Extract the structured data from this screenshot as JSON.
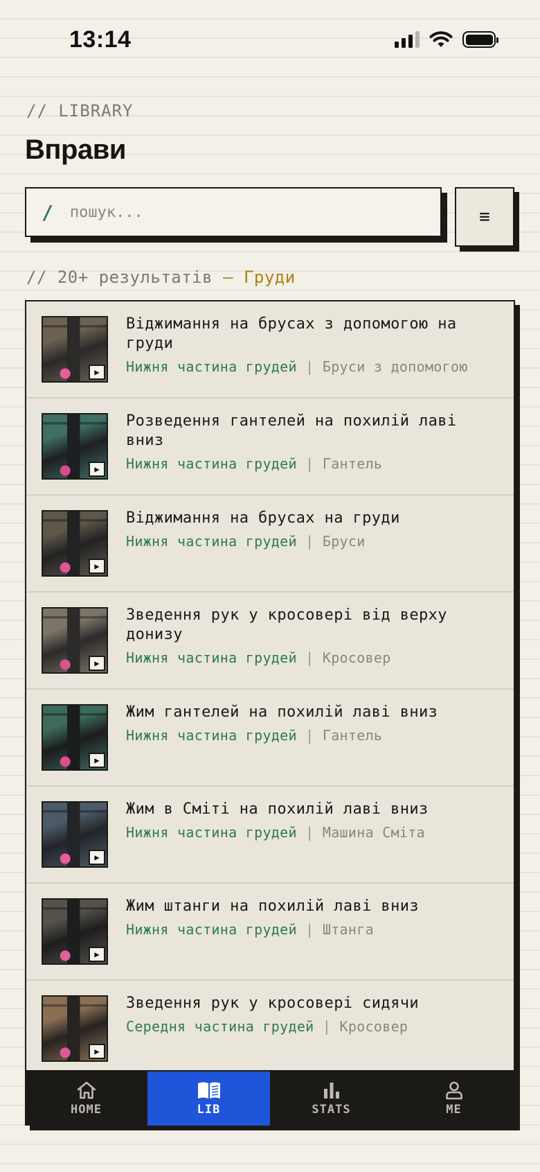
{
  "status_bar": {
    "time": "13:14"
  },
  "header": {
    "eyebrow": "// LIBRARY",
    "title": "Вправи"
  },
  "search": {
    "prefix": "/",
    "placeholder": "пошук...",
    "value": ""
  },
  "filter_button": {
    "icon": "filter-lines-icon",
    "glyph": "≡"
  },
  "results": {
    "prefix": "// 20+ результатів",
    "dash": " — ",
    "filter": "Груди"
  },
  "exercises": [
    {
      "title": "Віджимання на брусах з допомогою на груди",
      "muscle": "Нижня частина грудей",
      "separator": " | ",
      "equipment": "Бруси з допомогою",
      "thumb_colors": [
        "#6b6253",
        "#2b2a28",
        "#e85d9b"
      ]
    },
    {
      "title": "Розведення гантелей на похилій лаві вниз",
      "muscle": "Нижня частина грудей",
      "separator": " | ",
      "equipment": "Гантель",
      "thumb_colors": [
        "#3f6f63",
        "#1d1f22",
        "#d94d8f"
      ]
    },
    {
      "title": "Віджимання на брусах на груди",
      "muscle": "Нижня частина грудей",
      "separator": " | ",
      "equipment": "Бруси",
      "thumb_colors": [
        "#5e574c",
        "#222222",
        "#e05594"
      ]
    },
    {
      "title": "Зведення рук у кросовері від верху донизу",
      "muscle": "Нижня частина грудей",
      "separator": " | ",
      "equipment": "Кросовер",
      "thumb_colors": [
        "#7b7468",
        "#2c2b2a",
        "#d6558e"
      ]
    },
    {
      "title": "Жим гантелей на похилій лаві вниз",
      "muscle": "Нижня частина грудей",
      "separator": " | ",
      "equipment": "Гантель",
      "thumb_colors": [
        "#3d6a5c",
        "#1b1c1e",
        "#d9508c"
      ]
    },
    {
      "title": "Жим в Сміті на похилій лаві вниз",
      "muscle": "Нижня частина грудей",
      "separator": " | ",
      "equipment": "Машина Сміта",
      "thumb_colors": [
        "#4b5a66",
        "#222428",
        "#e85d9b"
      ]
    },
    {
      "title": "Жим штанги на похилій лаві вниз",
      "muscle": "Нижня частина грудей",
      "separator": " | ",
      "equipment": "Штанга",
      "thumb_colors": [
        "#55524c",
        "#1d1d1d",
        "#e0609a"
      ]
    },
    {
      "title": "Зведення рук у кросовері сидячи",
      "muscle": "Середня частина грудей",
      "separator": " | ",
      "equipment": "Кросовер",
      "thumb_colors": [
        "#8a6f55",
        "#262321",
        "#de5a95"
      ]
    }
  ],
  "tabs": [
    {
      "label": "HOME",
      "icon": "home-icon",
      "active": false
    },
    {
      "label": "LIB",
      "icon": "book-icon",
      "active": true
    },
    {
      "label": "STATS",
      "icon": "bar-chart-icon",
      "active": false
    },
    {
      "label": "ME",
      "icon": "user-icon",
      "active": false
    }
  ],
  "colors": {
    "accent_blue": "#1e55d9",
    "muscle_green": "#2f7a4f",
    "filter_gold": "#b0801a",
    "ink": "#1b1a16",
    "paper": "#f3f0e7"
  }
}
